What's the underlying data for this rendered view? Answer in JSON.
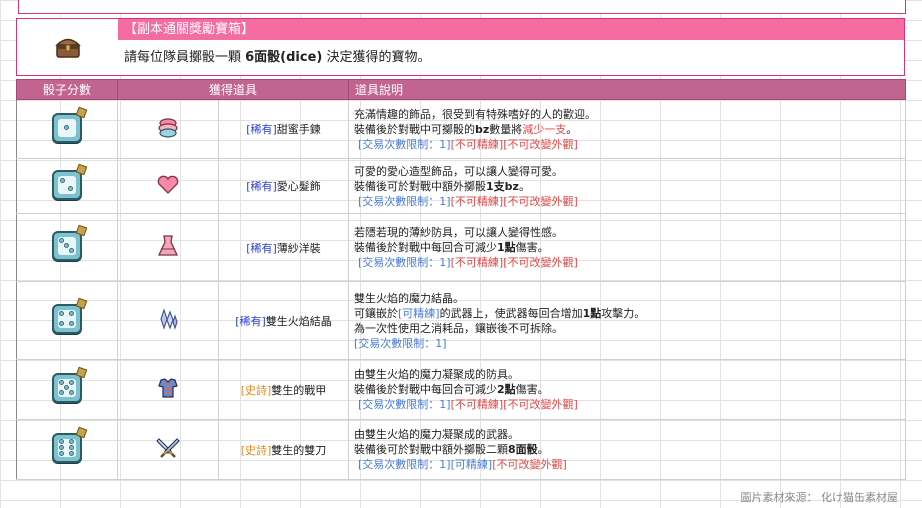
{
  "header": {
    "icon": "treasure-chest-icon",
    "title": "【副本通關獎勵寶箱】",
    "desc_prefix": "請每位隊員擲骰一顆 ",
    "desc_bold": "6面骰(dice)",
    "desc_suffix": " 決定獲得的寶物。"
  },
  "columns": {
    "dice": "骰子分數",
    "item": "獲得道具",
    "desc": "道具說明"
  },
  "rows": [
    {
      "dice_value": 1,
      "item_icon": "macaron-bracelet-icon",
      "rarity": "[稀有]",
      "name": "甜蜜手鍊",
      "line1": "充滿情趣的飾品，很受到有特殊嗜好的人的歡迎。",
      "line2_pre": "裝備後於對戰中可擲骰的",
      "line2_bold": "bz",
      "line2_mid": "數量將",
      "line2_red": "減少一支",
      "line2_end": "。",
      "tag_trade": "[交易次數限制：1]",
      "tag_refine": "[不可精練]",
      "tag_look": "[不可改變外觀]"
    },
    {
      "dice_value": 2,
      "item_icon": "heart-hairpin-icon",
      "rarity": "[稀有]",
      "name": "愛心髮飾",
      "line1": "可愛的愛心造型飾品，可以讓人變得可愛。",
      "line2_pre": "裝備後可於對戰中額外擲骰",
      "line2_bold": "1支bz",
      "line2_end": "。",
      "tag_trade": "[交易次數限制：1]",
      "tag_refine": "[不可精練]",
      "tag_look": "[不可改變外觀]"
    },
    {
      "dice_value": 3,
      "item_icon": "gauze-dress-icon",
      "rarity": "[稀有]",
      "name": "薄紗洋裝",
      "line1": "若隱若現的薄紗防具，可以讓人變得性感。",
      "line2_pre": "裝備後於對戰中每回合可減少",
      "line2_bold": "1點",
      "line2_end": "傷害。",
      "tag_trade": "[交易次數限制：1]",
      "tag_refine": "[不可精練]",
      "tag_look": "[不可改變外觀]"
    },
    {
      "dice_value": 4,
      "item_icon": "twin-flame-crystal-icon",
      "rarity": "[稀有]",
      "name": "雙生火焰結晶",
      "line1": "雙生火焰的魔力結晶。",
      "line2_a": "可鑲嵌於",
      "line2_tag": "[可精練]",
      "line2_b": "的武器上，使武器每回合增加",
      "line2_bold": "1點",
      "line2_c": "攻擊力。",
      "line3": "為一次性使用之消耗品，鑲嵌後不可拆除。",
      "tag_trade": "[交易次數限制：1]"
    },
    {
      "dice_value": 5,
      "item_icon": "twin-armor-icon",
      "rarity": "[史詩]",
      "name": "雙生的戰甲",
      "line1": "由雙生火焰的魔力凝聚成的防具。",
      "line2_pre": "裝備後於對戰中每回合可減少",
      "line2_bold": "2點",
      "line2_end": "傷害。",
      "tag_trade": "[交易次數限制：1]",
      "tag_refine": "[不可精練]",
      "tag_look": "[不可改變外觀]"
    },
    {
      "dice_value": 6,
      "item_icon": "twin-blades-icon",
      "rarity": "[史詩]",
      "name": "雙生的雙刀",
      "line1": "由雙生火焰的魔力凝聚成的武器。",
      "line2_pre": "裝備後可於對戰中額外擲骰二顆",
      "line2_bold": "8面骰",
      "line2_end": "。",
      "tag_trade": "[交易次數限制：1]",
      "tag_refine": "[可精練]",
      "tag_look": "[不可改變外觀]"
    }
  ],
  "footer": {
    "credit": "圖片素材來源： 化け猫缶素材屋"
  },
  "colors": {
    "accent_pink": "#f56ca3",
    "header_mauve": "#c1648f",
    "border_pink": "#d7337a",
    "rare_blue": "#2a3fd6",
    "epic_orange": "#e08a1f",
    "tag_blue": "#4a7cd6",
    "tag_red": "#e04848"
  }
}
